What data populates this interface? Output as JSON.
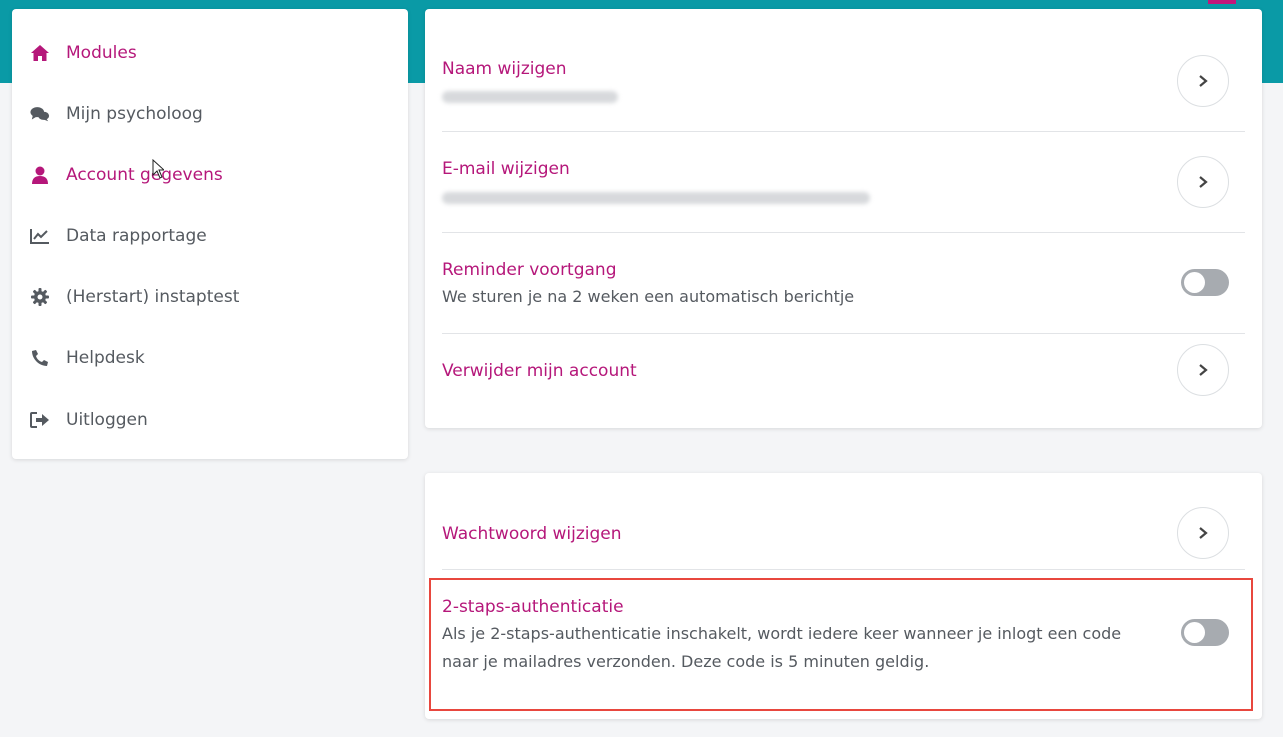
{
  "colors": {
    "topbar": "#0a9aa6",
    "accent": "#b5177a",
    "text": "#555a60",
    "highlight": "#e8473e"
  },
  "sidebar": {
    "items": [
      {
        "label": "Modules",
        "icon": "home-icon",
        "active": true
      },
      {
        "label": "Mijn psycholoog",
        "icon": "chat-icon",
        "active": false
      },
      {
        "label": "Account gegevens",
        "icon": "user-icon",
        "active": true
      },
      {
        "label": "Data rapportage",
        "icon": "line-chart-icon",
        "active": false
      },
      {
        "label": "(Herstart) instaptest",
        "icon": "gear-icon",
        "active": false
      },
      {
        "label": "Helpdesk",
        "icon": "phone-icon",
        "active": false
      },
      {
        "label": "Uitloggen",
        "icon": "sign-out-icon",
        "active": false
      }
    ]
  },
  "account": {
    "name_title": "Naam wijzigen",
    "email_title": "E-mail wijzigen",
    "reminder_title": "Reminder voortgang",
    "reminder_sub": "We sturen je na 2 weken een automatisch berichtje",
    "reminder_enabled": false,
    "delete_title": "Verwijder mijn account"
  },
  "security": {
    "password_title": "Wachtwoord wijzigen",
    "twofa_title": "2-staps-authenticatie",
    "twofa_line1": "Als je 2-staps-authenticatie inschakelt, wordt iedere keer wanneer je inlogt een code",
    "twofa_line2": "naar je mailadres verzonden. Deze code is 5 minuten geldig.",
    "twofa_enabled": false
  }
}
